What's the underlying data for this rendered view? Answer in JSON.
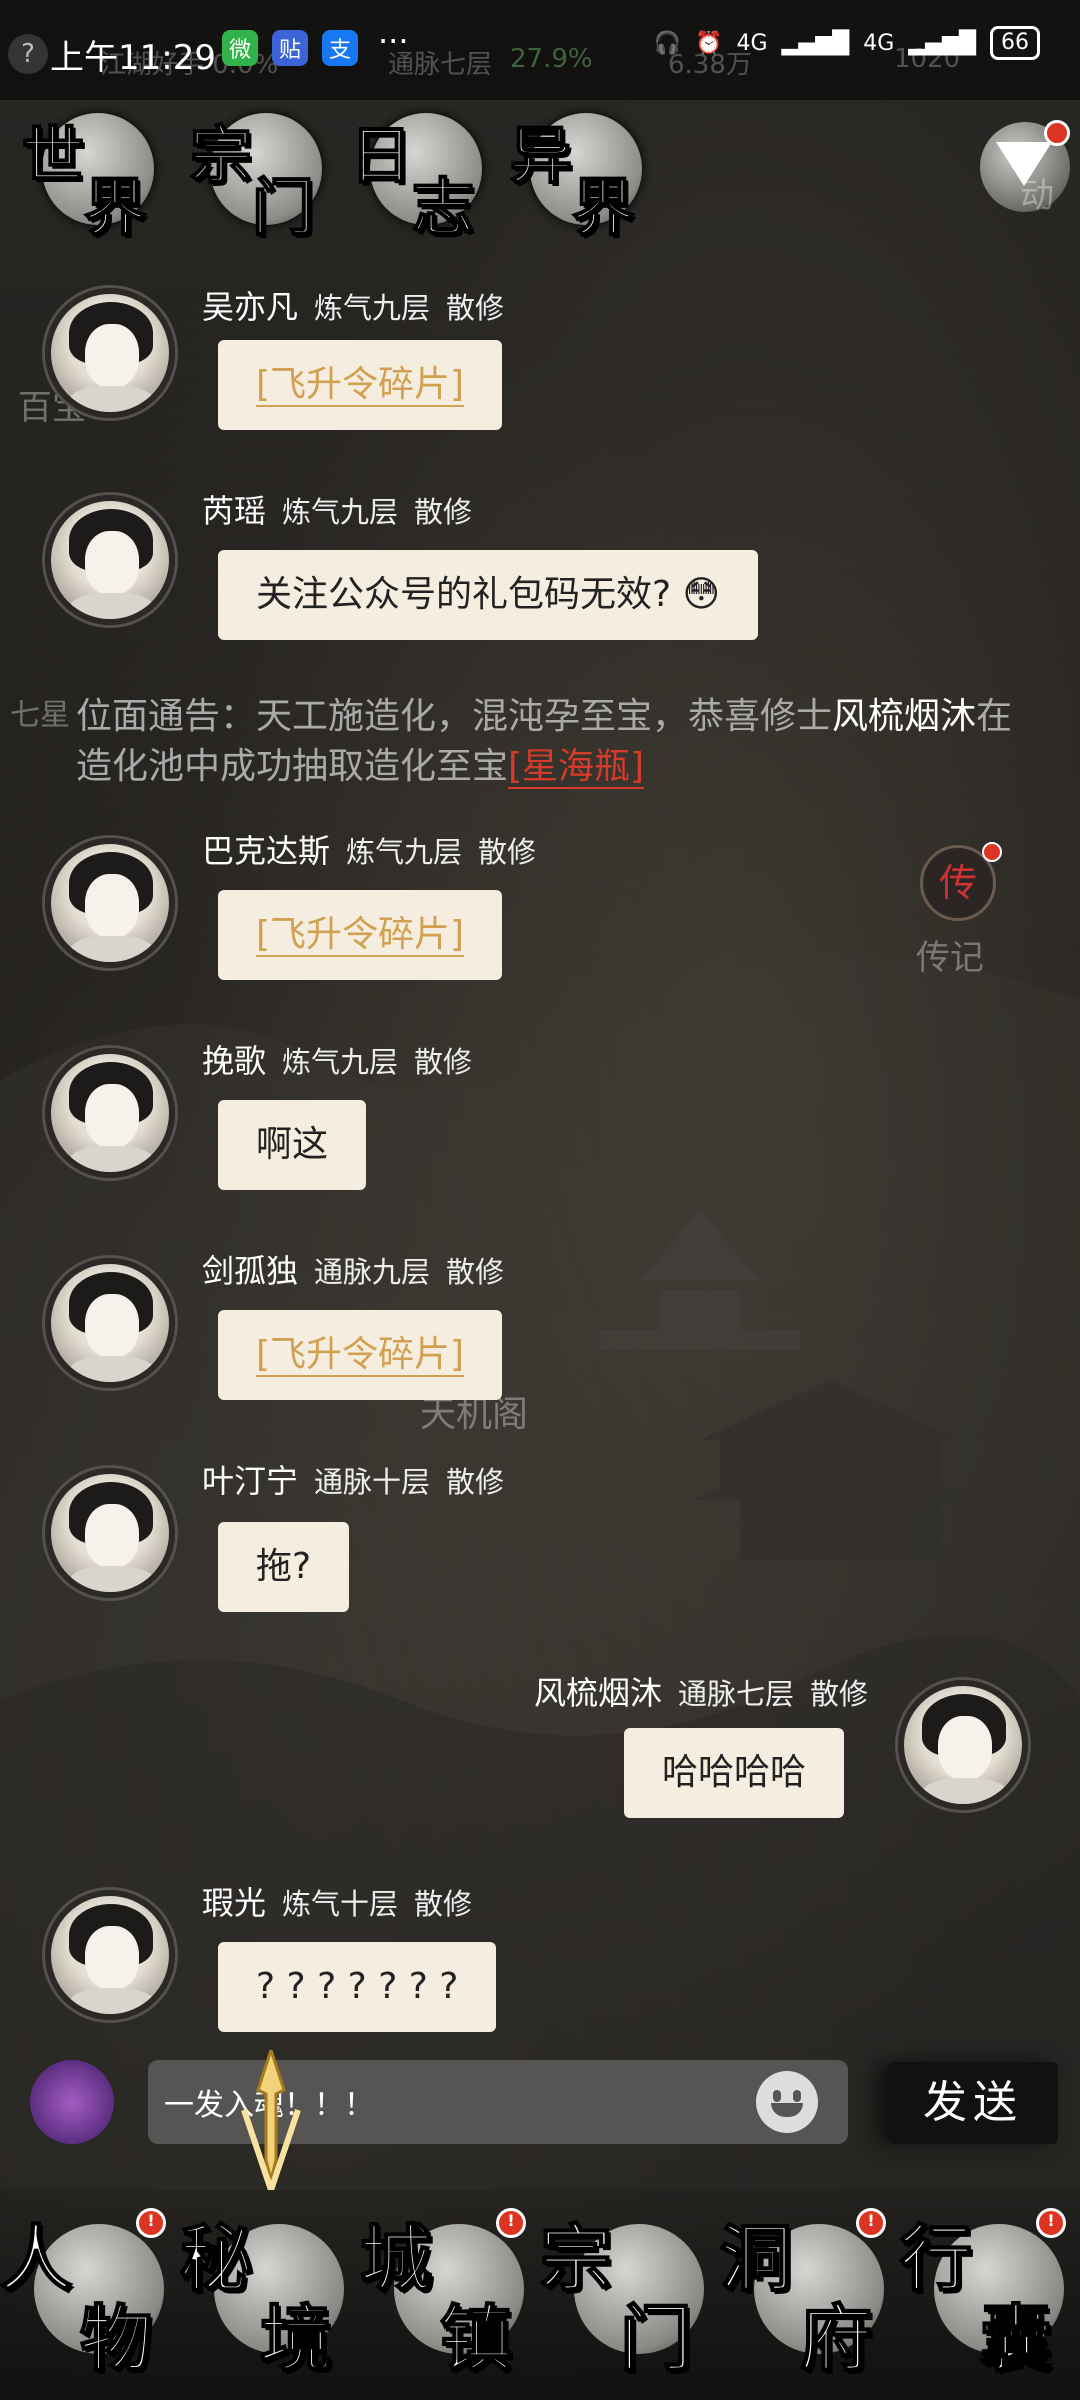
{
  "status_bar": {
    "time": "上午11:29",
    "app_icons": [
      "微",
      "贴",
      "支"
    ],
    "more": "···",
    "network_1": "4G",
    "network_2": "4G",
    "battery": "66",
    "ghost_left": "江湖好手 0.0%",
    "ghost_rank": "通脉七层",
    "ghost_pct": "27.9%",
    "ghost_money": "6.38万",
    "ghost_coins": "1020"
  },
  "top_tabs": [
    {
      "c1": "世",
      "c2": "界"
    },
    {
      "c1": "宗",
      "c2": "门"
    },
    {
      "c1": "日",
      "c2": "志"
    },
    {
      "c1": "异",
      "c2": "界"
    }
  ],
  "dynamic_label": "动",
  "side_labels": {
    "left_top": "百宝",
    "left_mid": "七星",
    "right_legend": "传记",
    "chuan": "传",
    "mid_building": "天机阁"
  },
  "messages": [
    {
      "name": "吴亦凡",
      "rank": "炼气九层",
      "sect": "散修",
      "text": "[飞升令碎片]",
      "type": "item"
    },
    {
      "name": "芮瑶",
      "rank": "炼气九层",
      "sect": "散修",
      "text": "关注公众号的礼包码无效? 😳",
      "type": "text"
    },
    {
      "name": "巴克达斯",
      "rank": "炼气九层",
      "sect": "散修",
      "text": "[飞升令碎片]",
      "type": "item"
    },
    {
      "name": "挽歌",
      "rank": "炼气九层",
      "sect": "散修",
      "text": "啊这",
      "type": "text"
    },
    {
      "name": "剑孤独",
      "rank": "通脉九层",
      "sect": "散修",
      "text": "[飞升令碎片]",
      "type": "item"
    },
    {
      "name": "叶汀宁",
      "rank": "通脉十层",
      "sect": "散修",
      "text": "拖?",
      "type": "text"
    },
    {
      "name": "风梳烟沐",
      "rank": "通脉七层",
      "sect": "散修",
      "text": "哈哈哈哈",
      "type": "self"
    },
    {
      "name": "瑕光",
      "rank": "炼气十层",
      "sect": "散修",
      "text": "? ? ? ? ? ? ?",
      "type": "text"
    }
  ],
  "notice": {
    "prefix": "位面通告：天工施造化，混沌孕至宝，恭喜修士",
    "who": "风梳烟沐",
    "middle": "在造化池中成功抽取造化至宝",
    "prize": "[星海瓶]"
  },
  "input": {
    "value": "一发入魂！！！",
    "send_label": "发送"
  },
  "bottom_nav": [
    {
      "c1": "人",
      "c2": "物",
      "badge": true
    },
    {
      "c1": "秘",
      "c2": "境",
      "badge": false
    },
    {
      "c1": "城",
      "c2": "镇",
      "badge": true
    },
    {
      "c1": "宗",
      "c2": "门",
      "badge": false
    },
    {
      "c1": "洞",
      "c2": "府",
      "badge": true
    },
    {
      "c1": "行",
      "c2": "囊",
      "badge": true
    }
  ],
  "badge_text": "!",
  "colors": {
    "bubble": "#f5eee0",
    "item_text": "#d1a050",
    "prize_red": "#d43b2b",
    "badge_red": "#dd3322"
  }
}
